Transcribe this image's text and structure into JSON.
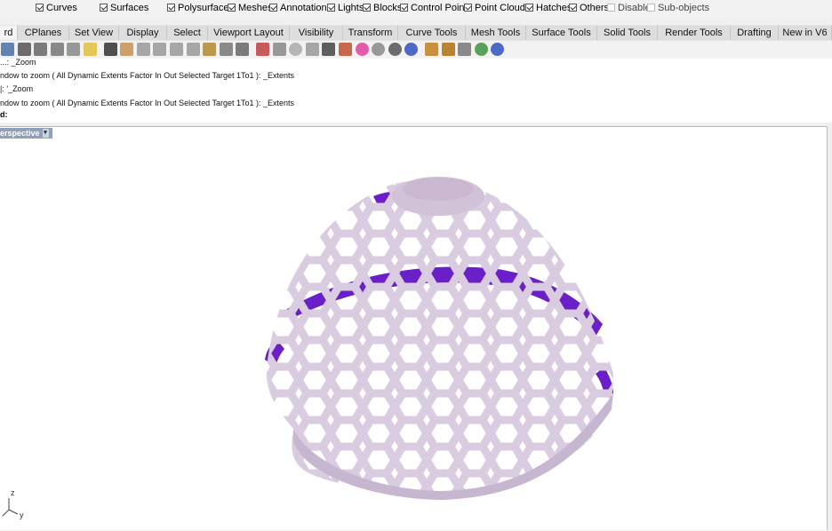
{
  "filters": [
    {
      "label": "Curves",
      "checked": true
    },
    {
      "label": "Surfaces",
      "checked": true
    },
    {
      "label": "Polysurfaces",
      "checked": true
    },
    {
      "label": "Meshes",
      "checked": true
    },
    {
      "label": "Annotations",
      "checked": true
    },
    {
      "label": "Lights",
      "checked": true
    },
    {
      "label": "Blocks",
      "checked": true
    },
    {
      "label": "Control Points",
      "checked": true
    },
    {
      "label": "Point Clouds",
      "checked": true
    },
    {
      "label": "Hatches",
      "checked": true
    },
    {
      "label": "Others",
      "checked": true
    },
    {
      "label": "Disable",
      "checked": false
    },
    {
      "label": "Sub-objects",
      "checked": false
    }
  ],
  "tabs": [
    "rd",
    "CPlanes",
    "Set View",
    "Display",
    "Select",
    "Viewport Layout",
    "Visibility",
    "Transform",
    "Curve Tools",
    "Mesh Tools",
    "Surface Tools",
    "Solid Tools",
    "Render Tools",
    "Drafting",
    "New in V6"
  ],
  "toolbar_icons": [
    "save-icon",
    "print-icon",
    "page-setup-icon",
    "cut-icon",
    "copy-icon",
    "paste-icon",
    "undo-icon",
    "pan-hand-icon",
    "move-icon",
    "zoom-icon",
    "zoom-window-icon",
    "zoom-extents-icon",
    "zoom-selected-icon",
    "rotate-view-icon",
    "four-viewports-icon",
    "car-icon",
    "camera-icon",
    "dot-icon",
    "light-icon",
    "lock-icon",
    "layer-icon",
    "color-wheel-icon",
    "shade-sphere-icon",
    "render-sphere-icon",
    "material-sphere-icon",
    "pen-icon",
    "gear-icon",
    "grid-snap-icon",
    "globe-icon",
    "help-icon"
  ],
  "command_history": [
    "...: _Zoom",
    "ndow to zoom ( All  Dynamic  Extents  Factor  In  Out  Selected  Target  1To1 ): _Extents",
    "|: '_Zoom",
    "ndow to zoom ( All  Dynamic  Extents  Factor  In  Out  Selected  Target  1To1 ): _Extents"
  ],
  "prompt": "d:",
  "viewport": {
    "title": "erspective",
    "axis_z": "z",
    "axis_y": "y"
  },
  "colors": {
    "mesh_light": "#d8c9dc",
    "mesh_shadow": "#a898b0",
    "mesh_inner": "#6a1fc8",
    "viewport_title_bg": "#8fa0b8"
  }
}
